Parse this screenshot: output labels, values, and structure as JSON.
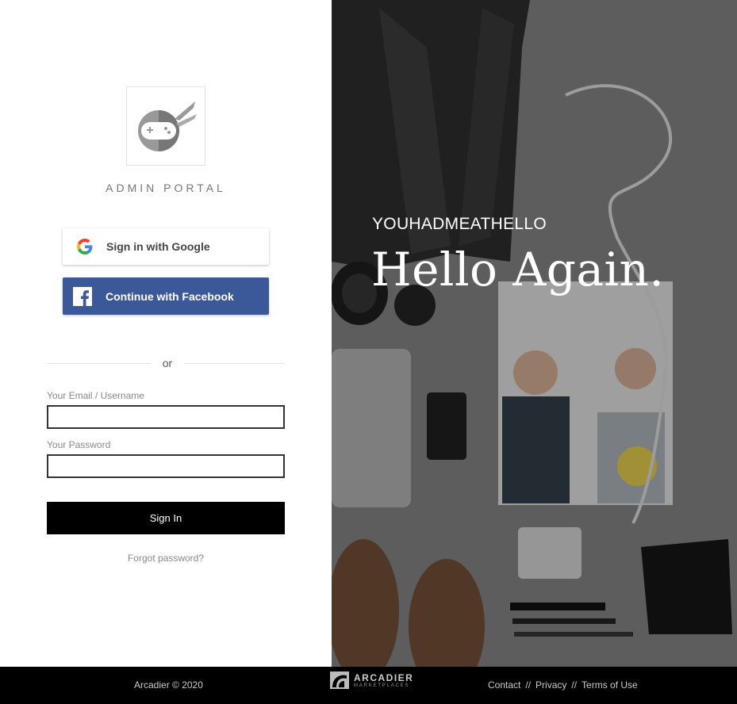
{
  "brand": {
    "portal_title": "ADMIN PORTAL",
    "logo_icon": "ninja-gamepad-icon"
  },
  "social": {
    "google_label": "Sign in with Google",
    "facebook_label": "Continue with Facebook",
    "divider_text": "or"
  },
  "form": {
    "email_label": "Your Email / Username",
    "email_value": "",
    "password_label": "Your Password",
    "password_value": "",
    "signin_label": "Sign In",
    "forgot_label": "Forgot password?"
  },
  "hero": {
    "subtitle": "YOUHADMEATHELLO",
    "title": "Hello Again."
  },
  "footer": {
    "copyright": "Arcadier © 2020",
    "brand_name": "ARCADIER",
    "brand_sub": "MARKETPLACES",
    "links": [
      "Contact",
      "Privacy",
      "Terms of Use"
    ],
    "separator": "//"
  },
  "colors": {
    "facebook": "#3b5998",
    "signin": "#000000",
    "footer_bg": "#000000"
  }
}
